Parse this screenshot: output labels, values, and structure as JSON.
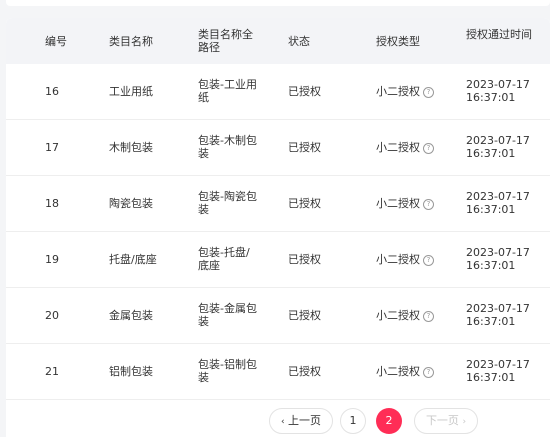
{
  "table": {
    "headers": {
      "id": "编号",
      "name": "类目名称",
      "path": "类目名称全路径",
      "status": "状态",
      "type": "授权类型",
      "time": "授权通过时间"
    },
    "rows": [
      {
        "id": "16",
        "name": "工业用纸",
        "path": "包装-工业用纸",
        "status": "已授权",
        "type": "小二授权",
        "time": "2023-07-17 16:37:01"
      },
      {
        "id": "17",
        "name": "木制包装",
        "path": "包装-木制包装",
        "status": "已授权",
        "type": "小二授权",
        "time": "2023-07-17 16:37:01"
      },
      {
        "id": "18",
        "name": "陶瓷包装",
        "path": "包装-陶瓷包装",
        "status": "已授权",
        "type": "小二授权",
        "time": "2023-07-17 16:37:01"
      },
      {
        "id": "19",
        "name": "托盘/底座",
        "path": "包装-托盘/底座",
        "status": "已授权",
        "type": "小二授权",
        "time": "2023-07-17 16:37:01"
      },
      {
        "id": "20",
        "name": "金属包装",
        "path": "包装-金属包装",
        "status": "已授权",
        "type": "小二授权",
        "time": "2023-07-17 16:37:01"
      },
      {
        "id": "21",
        "name": "铝制包装",
        "path": "包装-铝制包装",
        "status": "已授权",
        "type": "小二授权",
        "time": "2023-07-17 16:37:01"
      }
    ]
  },
  "pagination": {
    "prev_label": "上一页",
    "next_label": "下一页",
    "page1": "1",
    "page2": "2",
    "current_page": 2,
    "accent_color": "#ff2d56"
  },
  "icons": {
    "help": "help-circle-icon",
    "prev": "chevron-left-icon",
    "next": "chevron-right-icon"
  }
}
